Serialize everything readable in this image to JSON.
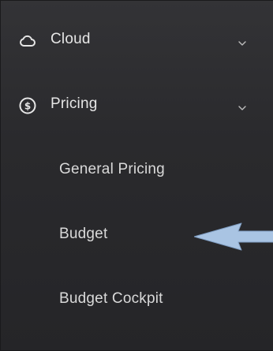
{
  "sidebar": {
    "groups": [
      {
        "label": "Cloud",
        "icon": "cloud-icon",
        "expanded": false
      },
      {
        "label": "Pricing",
        "icon": "dollar-circle-icon",
        "expanded": true,
        "items": [
          {
            "label": "General Pricing"
          },
          {
            "label": "Budget"
          },
          {
            "label": "Budget Cockpit"
          }
        ]
      }
    ]
  },
  "annotation": {
    "pointer": "arrow-left-icon",
    "color": "#a9c4e3"
  },
  "colors": {
    "background": "#2b2b2e",
    "text": "#e6e6e6"
  }
}
